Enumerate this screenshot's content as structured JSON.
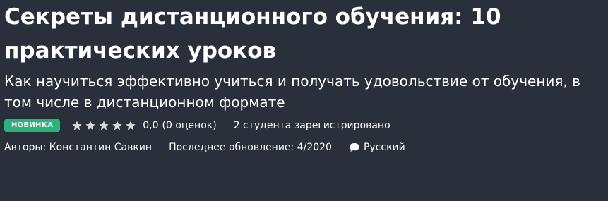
{
  "course": {
    "title": "Секреты дистанционного обучения: 10 практических уроков",
    "subtitle": "Как научиться эффективно учиться и получать удовольствие от обучения, в том числе в дистанционном формате",
    "badge": "НОВИНКА",
    "rating": {
      "stars_filled": 0,
      "stars_total": 5,
      "value": "0,0",
      "count_text": "(0 оценок)"
    },
    "enrolled": "2 студента зарегистрировано",
    "authors_text": "Авторы: Константин Савкин",
    "last_updated": "Последнее обновление: 4/2020",
    "language": "Русский"
  },
  "colors": {
    "background": "#29303b",
    "badge": "#2ab27b",
    "star": "#d8d8d8",
    "text": "#ffffff"
  },
  "icons": {
    "star": "star-icon",
    "language": "speech-bubble-icon"
  }
}
